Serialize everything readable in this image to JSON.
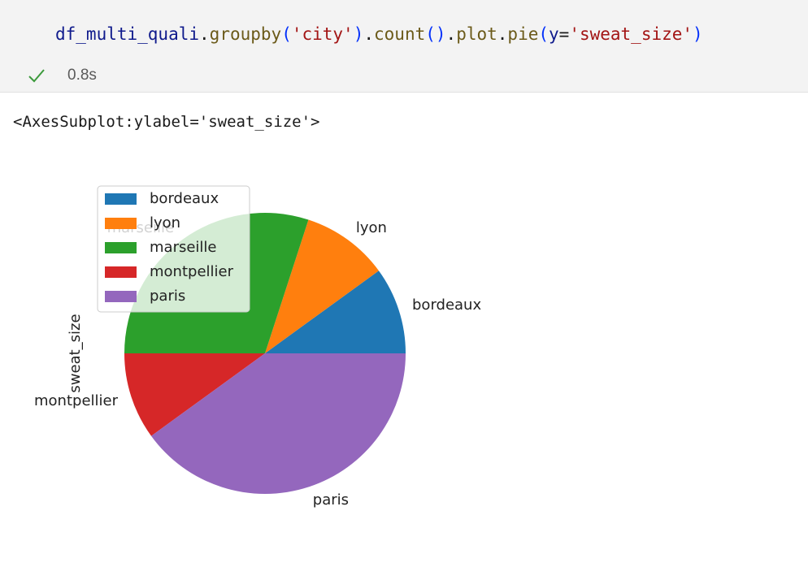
{
  "cell": {
    "code_tokens": [
      {
        "text": "df_multi_quali",
        "cls": "tok-var"
      },
      {
        "text": ".",
        "cls": "tok-plain"
      },
      {
        "text": "groupby",
        "cls": "tok-fn"
      },
      {
        "text": "(",
        "cls": "tok-paren1"
      },
      {
        "text": "'city'",
        "cls": "tok-str"
      },
      {
        "text": ")",
        "cls": "tok-paren1"
      },
      {
        "text": ".",
        "cls": "tok-plain"
      },
      {
        "text": "count",
        "cls": "tok-fn"
      },
      {
        "text": "()",
        "cls": "tok-paren1"
      },
      {
        "text": ".",
        "cls": "tok-plain"
      },
      {
        "text": "plot",
        "cls": "tok-fn"
      },
      {
        "text": ".",
        "cls": "tok-plain"
      },
      {
        "text": "pie",
        "cls": "tok-fn"
      },
      {
        "text": "(",
        "cls": "tok-paren1"
      },
      {
        "text": "y",
        "cls": "tok-var"
      },
      {
        "text": "=",
        "cls": "tok-plain"
      },
      {
        "text": "'sweat_size'",
        "cls": "tok-str"
      },
      {
        "text": ")",
        "cls": "tok-paren1"
      }
    ],
    "status_icon": "check-icon",
    "status_color": "#3c9a3c",
    "exec_time": "0.8s"
  },
  "output": {
    "repr": "<AxesSubplot:ylabel='sweat_size'>"
  },
  "chart_data": {
    "type": "pie",
    "categories": [
      "bordeaux",
      "lyon",
      "marseille",
      "montpellier",
      "paris"
    ],
    "values": [
      1,
      1,
      3,
      1,
      4
    ],
    "colors": [
      "#1f77b4",
      "#ff7f0e",
      "#2ca02c",
      "#d62728",
      "#9467bd"
    ],
    "ylabel": "sweat_size",
    "legend": {
      "placement": "upper-left",
      "entries": [
        "bordeaux",
        "lyon",
        "marseille",
        "montpellier",
        "paris"
      ]
    },
    "start_angle_deg": 0,
    "direction": "counterclockwise"
  }
}
